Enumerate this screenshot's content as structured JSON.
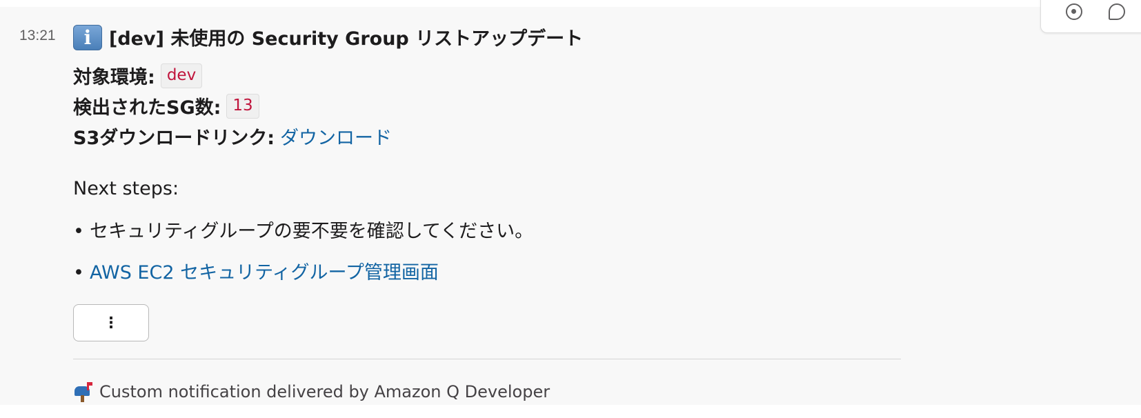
{
  "message": {
    "timestamp": "13:21",
    "title": "[dev] 未使用の Security Group リストアップデート",
    "fields": [
      {
        "label": "対象環境:",
        "value": "dev",
        "kind": "code"
      },
      {
        "label": "検出されたSG数:",
        "value": "13",
        "kind": "code"
      },
      {
        "label": "S3ダウンロードリンク:",
        "value": "ダウンロード",
        "kind": "link"
      }
    ],
    "next_steps_label": "Next steps:",
    "bullets": [
      {
        "text": "セキュリティグループの要不要を確認してください。",
        "kind": "text"
      },
      {
        "text": "AWS EC2 セキュリティグループ管理画面",
        "kind": "link"
      }
    ],
    "more_button_label": "⋮",
    "footer_text": "Custom notification delivered by Amazon Q Developer"
  },
  "icons": {
    "info": "information-icon",
    "mailbox": "mailbox-icon",
    "toolbar": [
      "add-reaction-icon",
      "reply-in-thread-icon"
    ]
  },
  "colors": {
    "link": "#1264a3",
    "code_text": "#c0143c",
    "info_icon": "#5b8fc7"
  }
}
